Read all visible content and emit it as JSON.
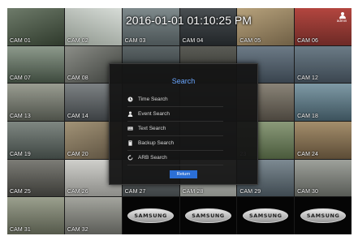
{
  "datetime": "2016-01-01 01:10:25 PM",
  "user": "admin",
  "cameras": [
    {
      "label": "CAM 01",
      "bg": "linear-gradient(160deg,#6e7b6a,#2f3a2c)"
    },
    {
      "label": "CAM 02",
      "bg": "linear-gradient(200deg,#d7dcd7,#8d958c)"
    },
    {
      "label": "CAM 03",
      "bg": "linear-gradient(180deg,#7f8a8c,#4b5456)"
    },
    {
      "label": "CAM 04",
      "bg": "linear-gradient(180deg,#4a4f52,#222629)"
    },
    {
      "label": "CAM 05",
      "bg": "linear-gradient(160deg,#b7a27c,#6f5f45)"
    },
    {
      "label": "CAM 06",
      "bg": "linear-gradient(180deg,#b3463f,#6d2a26)"
    },
    {
      "label": "CAM 07",
      "bg": "linear-gradient(180deg,#8d9a8c,#3e4a3e)"
    },
    {
      "label": "CAM 08",
      "bg": "linear-gradient(150deg,#8c8e88,#3c3f3b)"
    },
    {
      "label": "",
      "bg": "linear-gradient(180deg,#5b6466,#2b3233)"
    },
    {
      "label": "",
      "bg": "linear-gradient(180deg,#5a5b55,#2e2f2b)"
    },
    {
      "label": "",
      "bg": "linear-gradient(180deg,#6c7a86,#39444e)"
    },
    {
      "label": "CAM 12",
      "bg": "linear-gradient(180deg,#6b7b86,#3b4650)"
    },
    {
      "label": "CAM 13",
      "bg": "linear-gradient(180deg,#9a9d92,#4d5149)"
    },
    {
      "label": "CAM 14",
      "bg": "linear-gradient(180deg,#7d8284,#3c4043)"
    },
    {
      "label": "",
      "bg": "linear-gradient(180deg,#55595a,#2a2d2e)"
    },
    {
      "label": "",
      "bg": "linear-gradient(180deg,#5a5f60,#2c2f30)"
    },
    {
      "label": "",
      "bg": "linear-gradient(180deg,#8a8478,#4b463e)"
    },
    {
      "label": "CAM 18",
      "bg": "linear-gradient(180deg,#7f9aa6,#3c525c)"
    },
    {
      "label": "CAM 19",
      "bg": "linear-gradient(180deg,#7f8782,#3e4642)"
    },
    {
      "label": "CAM 20",
      "bg": "linear-gradient(160deg,#a29377,#5a4f3e)"
    },
    {
      "label": "",
      "bg": "linear-gradient(180deg,#55595a,#2a2d2e)"
    },
    {
      "label": "",
      "bg": "linear-gradient(180deg,#5a5e60,#2d3032)"
    },
    {
      "label": "23",
      "bg": "linear-gradient(180deg,#8b9a7a,#4a5a3c)"
    },
    {
      "label": "CAM 24",
      "bg": "linear-gradient(180deg,#a48e6c,#5c4c36)"
    },
    {
      "label": "CAM 25",
      "bg": "linear-gradient(180deg,#7c7c76,#3b3b37)"
    },
    {
      "label": "CAM 26",
      "bg": "linear-gradient(180deg,#cfcfcb,#8c8c88)"
    },
    {
      "label": "CAM 27",
      "bg": "linear-gradient(180deg,#7b8182,#3d4244)"
    },
    {
      "label": "CAM 28",
      "bg": "linear-gradient(180deg,#c9cbc6,#878a85)"
    },
    {
      "label": "CAM 29",
      "bg": "linear-gradient(180deg,#7d8a92,#3f4a51)"
    },
    {
      "label": "CAM 30",
      "bg": "linear-gradient(180deg,#9ea19b,#585b56)"
    },
    {
      "label": "CAM 31",
      "bg": "linear-gradient(180deg,#9ba08e,#55594b)"
    },
    {
      "label": "CAM 32",
      "bg": "linear-gradient(180deg,#a4a59e,#5b5c57)"
    },
    {
      "label": "",
      "bg": "logo"
    },
    {
      "label": "",
      "bg": "logo"
    },
    {
      "label": "",
      "bg": "logo"
    },
    {
      "label": "",
      "bg": "logo"
    }
  ],
  "brand": "SAMSUNG",
  "search": {
    "title": "Search",
    "items": [
      {
        "label": "Time Search",
        "icon": "clock-icon"
      },
      {
        "label": "Event Search",
        "icon": "person-icon"
      },
      {
        "label": "Text Search",
        "icon": "keyboard-icon"
      },
      {
        "label": "Backup Search",
        "icon": "storage-icon"
      },
      {
        "label": "ARB Search",
        "icon": "sync-icon"
      }
    ],
    "return_label": "Return"
  }
}
